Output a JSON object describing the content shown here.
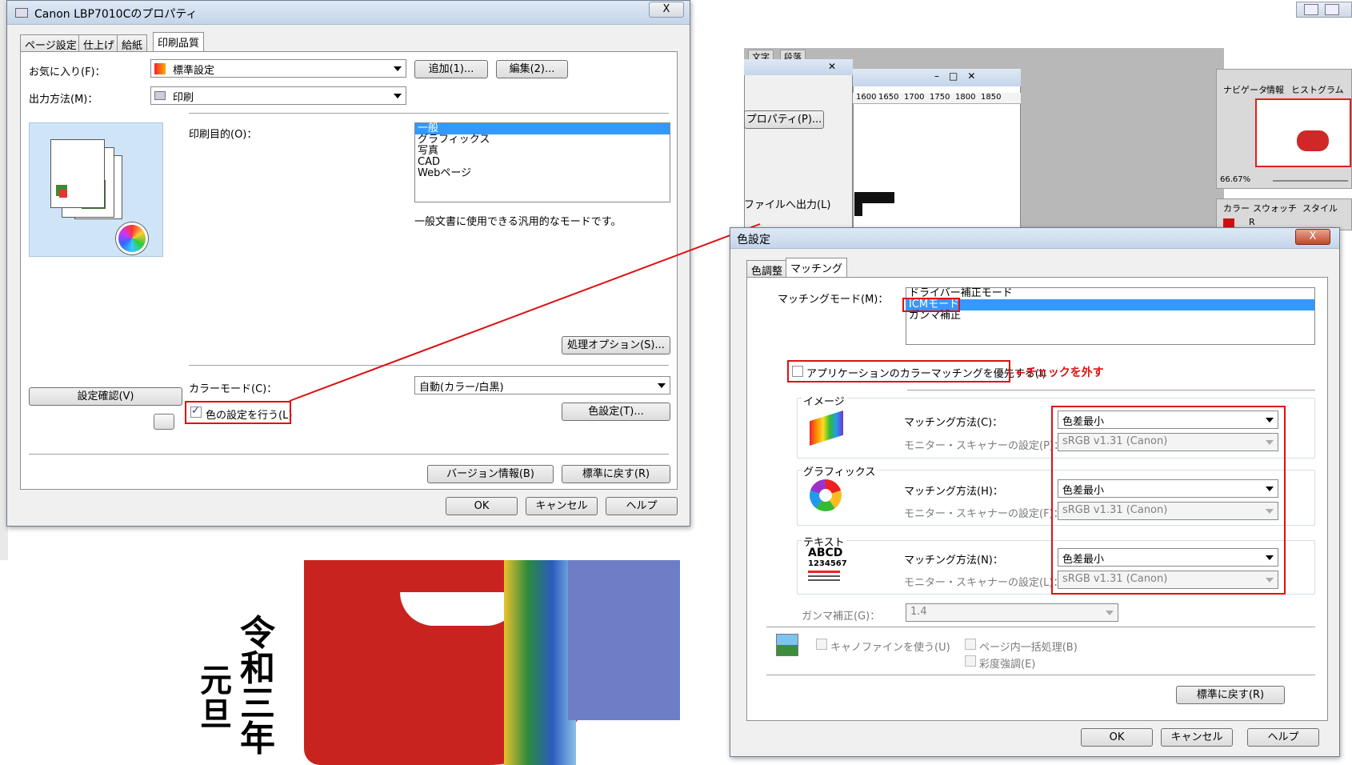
{
  "background": {
    "calligraphy": "令和三年",
    "calligraphy2": "元旦",
    "bg_tabs": [
      "文字",
      "段落"
    ],
    "ruler": [
      "1600",
      "1650",
      "1700",
      "1750",
      "1800",
      "1850"
    ],
    "mid_dialog": {
      "props_button": "プロパティ(P)...",
      "print_to_file": "ファイルへ出力(L)"
    },
    "right_panel": {
      "tabs_top": [
        "ナビゲータ",
        "情報",
        "ヒストグラム"
      ],
      "zoom": "66.67%",
      "tabs_bottom": [
        "カラー",
        "スウォッチ",
        "スタイル"
      ],
      "channel": "R"
    }
  },
  "main_dialog": {
    "title": "Canon LBP7010Cのプロパティ",
    "close": "X",
    "tabs": [
      "ページ設定",
      "仕上げ",
      "給紙",
      "印刷品質"
    ],
    "favorites_label": "お気に入り(F)：",
    "favorites_value": "標準設定",
    "add_button": "追加(1)...",
    "edit_button": "編集(2)...",
    "output_label": "出力方法(M)：",
    "output_value": "印刷",
    "purpose_label": "印刷目的(O)：",
    "purpose_items": [
      "一般",
      "グラフィックス",
      "写真",
      "CAD",
      "Webページ"
    ],
    "purpose_description": "一般文書に使用できる汎用的なモードです。",
    "process_options_button": "処理オプション(S)...",
    "confirm_settings_button": "設定確認(V)",
    "color_mode_label": "カラーモード(C)：",
    "color_mode_value": "自動(カラー/白黒)",
    "color_settings_checkbox": "色の設定を行う(L)",
    "color_settings_button": "色設定(T)...",
    "version_button": "バージョン情報(B)",
    "restore_button": "標準に戻す(R)",
    "ok": "OK",
    "cancel": "キャンセル",
    "help": "ヘルプ"
  },
  "color_dialog": {
    "title": "色設定",
    "close": "X",
    "tabs": [
      "色調整",
      "マッチング"
    ],
    "matching_mode_label": "マッチングモード(M)：",
    "matching_modes": [
      "ドライバー補正モード",
      "ICMモード",
      "ガンマ補正"
    ],
    "app_priority_checkbox": "アプリケーションのカラーマッチングを優先する(I)",
    "annotation": "←チェックを外す",
    "image_group": "イメージ",
    "image_method_label": "マッチング方法(C)：",
    "image_method_value": "色差最小",
    "image_profile_label": "モニター・スキャナーの設定(P)：",
    "image_profile_value": "sRGB v1.31 (Canon)",
    "graphics_group": "グラフィックス",
    "graphics_method_label": "マッチング方法(H)：",
    "graphics_method_value": "色差最小",
    "graphics_profile_label": "モニター・スキャナーの設定(F)：",
    "graphics_profile_value": "sRGB v1.31 (Canon)",
    "text_group": "テキスト",
    "text_icon_line1": "ABCD",
    "text_icon_line2": "1234567",
    "text_method_label": "マッチング方法(N)：",
    "text_method_value": "色差最小",
    "text_profile_label": "モニター・スキャナーの設定(L)：",
    "text_profile_value": "sRGB v1.31 (Canon)",
    "gamma_label": "ガンマ補正(G)：",
    "gamma_value": "1.4",
    "canofine_checkbox": "キャノファインを使う(U)",
    "page_batch_checkbox": "ページ内一括処理(B)",
    "saturation_checkbox": "彩度強調(E)",
    "restore_button": "標準に戻す(R)",
    "ok": "OK",
    "cancel": "キャンセル",
    "help": "ヘルプ"
  }
}
